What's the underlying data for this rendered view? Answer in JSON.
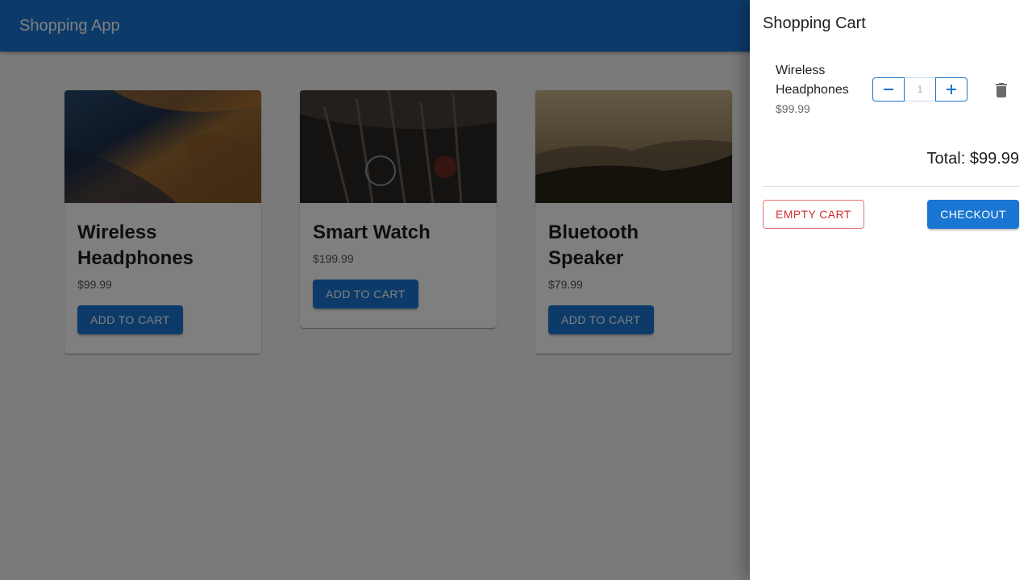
{
  "app": {
    "title": "Shopping App"
  },
  "products": [
    {
      "title": "Wireless Headphones",
      "price": "$99.99",
      "button": "ADD TO CART"
    },
    {
      "title": "Smart Watch",
      "price": "$199.99",
      "button": "ADD TO CART"
    },
    {
      "title": "Bluetooth Speaker",
      "price": "$79.99",
      "button": "ADD TO CART"
    }
  ],
  "cart": {
    "title": "Shopping Cart",
    "items": [
      {
        "name": "Wireless Headphones",
        "price": "$99.99",
        "quantity": "1",
        "decrement_icon": "minus-icon",
        "increment_icon": "plus-icon",
        "delete_icon": "trash-icon"
      }
    ],
    "total": "Total: $99.99",
    "empty_label": "EMPTY CART",
    "checkout_label": "CHECKOUT"
  },
  "colors": {
    "primary": "#1976d2",
    "danger": "#d32f2f"
  }
}
